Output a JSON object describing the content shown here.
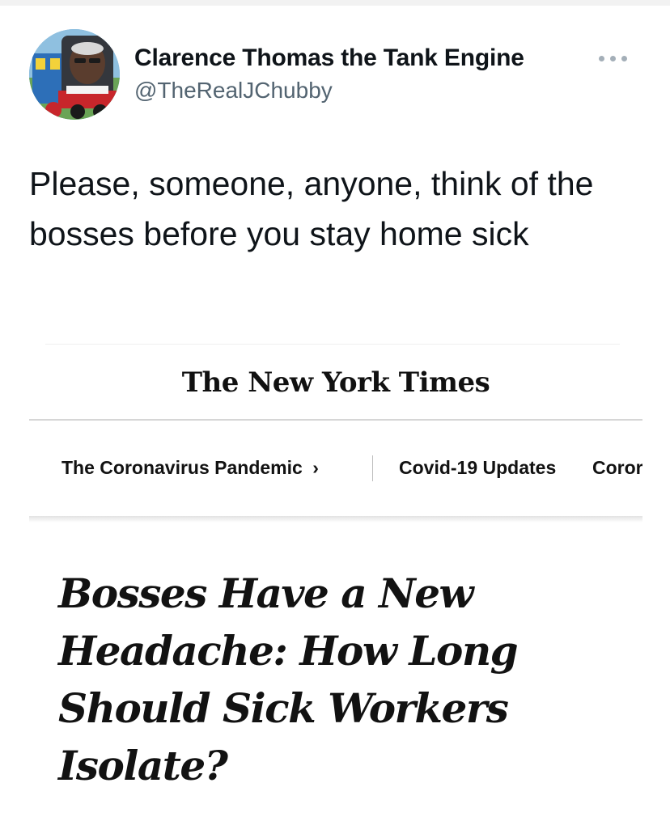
{
  "tweet": {
    "author_name": "Clarence Thomas the Tank Engine",
    "author_handle": "@TheRealJChubby",
    "avatar_icon": "train-avatar-icon",
    "more_icon": "more-options-icon",
    "text": "Please, someone, anyone, think of the bosses before you stay home sick"
  },
  "article": {
    "masthead": "The New York Times",
    "nav": {
      "section": "The Coronavirus Pandemic",
      "section_arrow": "›",
      "updates": "Covid-19 Updates",
      "truncated": "Coror"
    },
    "headline": "Bosses Have a New Headache: How Long Should Sick Workers Isolate?"
  },
  "colors": {
    "text": "#0f1419",
    "handle": "#536471",
    "background": "#ffffff"
  }
}
